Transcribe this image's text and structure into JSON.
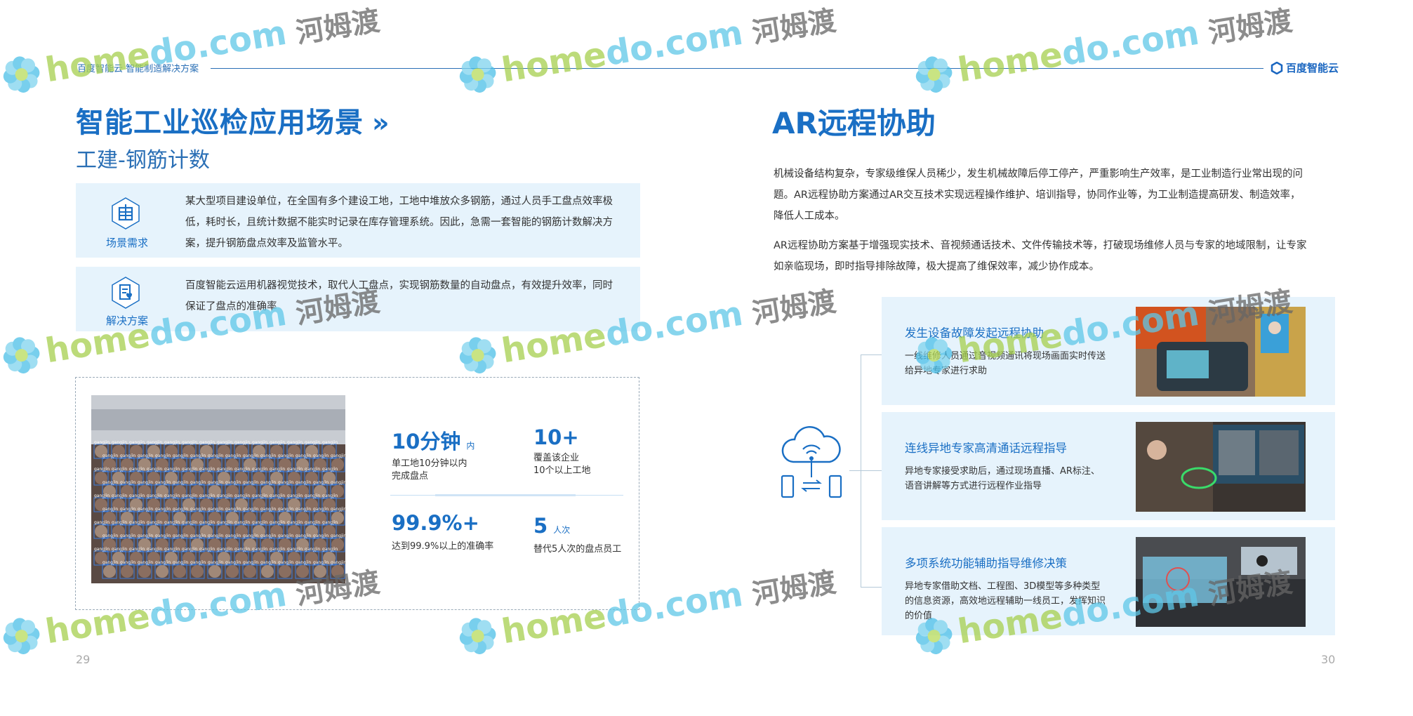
{
  "header": {
    "left_text": "百度智能云  智能制造解决方案",
    "logo_text": "百度智能云"
  },
  "left": {
    "title": "智能工业巡检应用场景",
    "title_chevrons": "»",
    "subtitle": "工建-钢筋计数",
    "box1": {
      "label": "场景需求",
      "icon": "building-icon",
      "text": "某大型项目建设单位，在全国有多个建设工地，工地中堆放众多钢筋，通过人员手工盘点效率极低，耗时长，且统计数据不能实时记录在库存管理系统。因此，急需一套智能的钢筋计数解决方案，提升钢筋盘点效率及监管水平。"
    },
    "box2": {
      "label": "解决方案",
      "icon": "document-heart-icon",
      "text": "百度智能云运用机器视觉技术，取代人工盘点，实现钢筋数量的自动盘点，有效提升效率，同时保证了盘点的准确率"
    },
    "photo_tag": "gangjin",
    "stats": [
      {
        "value": "10分钟",
        "unit": "内",
        "desc": [
          "单工地10分钟以内",
          "完成盘点"
        ]
      },
      {
        "value": "10+",
        "unit": "",
        "desc": [
          "覆盖该企业",
          "10个以上工地"
        ]
      },
      {
        "value": "99.9%+",
        "unit": "",
        "desc": [
          "达到99.9%以上的准确率"
        ]
      },
      {
        "value": "5",
        "unit": "人次",
        "desc": [
          "替代5人次的盘点员工"
        ]
      }
    ],
    "page_number": "29"
  },
  "right": {
    "title": "AR远程协助",
    "para1": "机械设备结构复杂，专家级维保人员稀少，发生机械故障后停工停产，严重影响生产效率，是工业制造行业常出现的问题。AR远程协助方案通过AR交互技术实现远程操作维护、培训指导，协同作业等，为工业制造提高研发、制造效率，降低人工成本。",
    "para2": "AR远程协助方案基于增强现实技术、音视频通话技术、文件传输技术等，打破现场维修人员与专家的地域限制，让专家如亲临现场，即时指导排除故障，极大提高了维保效率，减少协作成本。",
    "hub_icon": "cloud-devices-icon",
    "cards": [
      {
        "title": "发生设备故障发起远程协助",
        "desc": "一线维修人员通过音视频通讯将现场画面实时传送给异地专家进行求助"
      },
      {
        "title": "连线异地专家高清通话远程指导",
        "desc": "异地专家接受求助后，通过现场直播、AR标注、语音讲解等方式进行远程作业指导"
      },
      {
        "title": "多项系统功能辅助指导维修决策",
        "desc": "异地专家借助文档、工程图、3D模型等多种类型的信息资源，高效地远程辅助一线员工，发挥知识的价值"
      }
    ],
    "page_number": "30"
  },
  "watermark": {
    "brand_a": "home",
    "brand_b": "do",
    "domain": ".com",
    "cn": "河姆渡"
  },
  "colors": {
    "accent": "#1a6fc4",
    "panel_bg": "#e6f3fc"
  }
}
